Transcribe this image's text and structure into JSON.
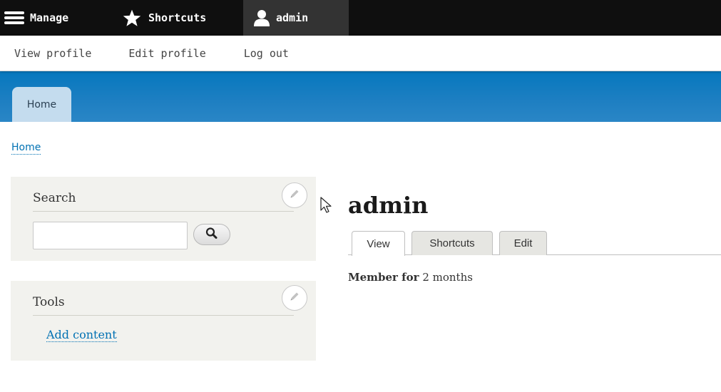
{
  "toolbar": {
    "manage_label": "Manage",
    "shortcuts_label": "Shortcuts",
    "user_label": "admin",
    "icons": {
      "manage": "hamburger-menu-icon",
      "shortcuts": "star-icon",
      "user": "person-icon"
    }
  },
  "user_tray": {
    "links": [
      "View profile",
      "Edit profile",
      "Log out"
    ]
  },
  "header": {
    "primary_tab": "Home"
  },
  "breadcrumb": {
    "home": "Home"
  },
  "sidebar": {
    "search_block": {
      "title": "Search",
      "input_value": "",
      "icons": {
        "edit": "pencil-icon",
        "submit": "magnifier-icon"
      }
    },
    "tools_block": {
      "title": "Tools",
      "link": "Add content",
      "icons": {
        "edit": "pencil-icon"
      }
    }
  },
  "main": {
    "title": "admin",
    "tabs": [
      "View",
      "Shortcuts",
      "Edit"
    ],
    "active_tab": "View",
    "member_label": "Member for",
    "member_value": "2 months"
  },
  "colors": {
    "toolbar_bg": "#0f0f0f",
    "toolbar_active": "#333333",
    "header_blue": "#1e7fc2",
    "link_blue": "#0071b3",
    "sidebar_bg": "#f2f2ee"
  }
}
